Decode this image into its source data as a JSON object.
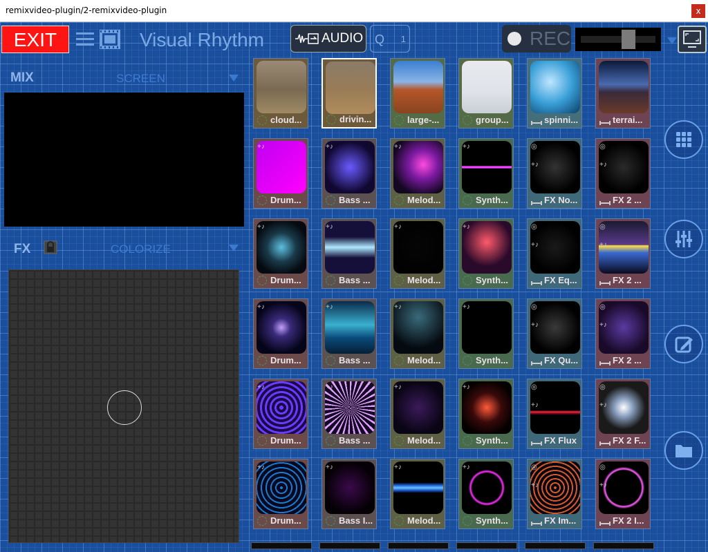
{
  "window": {
    "title": "remixvideo-plugin/2-remixvideo-plugin",
    "close_glyph": "x"
  },
  "toolbar": {
    "exit_label": "EXIT",
    "app_title": "Visual Rhythm",
    "audio_label": "AUDIO",
    "q_label": "Q",
    "q_value": "1",
    "rec_label": "REC",
    "rec_level": 0.67
  },
  "mix": {
    "label": "MIX",
    "screen_label": "SCREEN"
  },
  "fx": {
    "label": "FX",
    "effect_label": "COLORIZE"
  },
  "clips": [
    [
      {
        "label": "cloud...",
        "color": "#6d5a3a",
        "kind": "dot",
        "selected": false
      },
      {
        "label": "drivin...",
        "color": "#6d5a3a",
        "kind": "dot",
        "selected": true
      },
      {
        "label": "large-...",
        "color": "#556b47",
        "kind": "dot",
        "selected": false
      },
      {
        "label": "group...",
        "color": "#556b47",
        "kind": "dot",
        "selected": false
      },
      {
        "label": "spinni...",
        "color": "#436e7a",
        "kind": "fx",
        "selected": false
      },
      {
        "label": "terrai...",
        "color": "#6e4452",
        "kind": "fx",
        "selected": false
      }
    ],
    [
      {
        "label": "Drum...",
        "color": "#6d4a4a",
        "kind": "dot",
        "selected": false
      },
      {
        "label": "Bass ...",
        "color": "#5c5050",
        "kind": "dot",
        "selected": false
      },
      {
        "label": "Melod...",
        "color": "#5f5f45",
        "kind": "dot",
        "selected": false
      },
      {
        "label": "Synth...",
        "color": "#4a6a50",
        "kind": "dot",
        "selected": false
      },
      {
        "label": "FX No...",
        "color": "#3f6878",
        "kind": "fx",
        "selected": false
      },
      {
        "label": "FX 2 ...",
        "color": "#6e4452",
        "kind": "fx",
        "selected": false
      }
    ],
    [
      {
        "label": "Drum...",
        "color": "#6d4a4a",
        "kind": "dot",
        "selected": false
      },
      {
        "label": "Bass ...",
        "color": "#5c5050",
        "kind": "dot",
        "selected": false
      },
      {
        "label": "Melod...",
        "color": "#5f5f45",
        "kind": "dot",
        "selected": false
      },
      {
        "label": "Synth...",
        "color": "#4a6a50",
        "kind": "dot",
        "selected": false
      },
      {
        "label": "FX Eq...",
        "color": "#3f6878",
        "kind": "fx",
        "selected": false
      },
      {
        "label": "FX 2 ...",
        "color": "#6e4452",
        "kind": "fx",
        "selected": false
      }
    ],
    [
      {
        "label": "Drum...",
        "color": "#6d4a4a",
        "kind": "dot",
        "selected": false
      },
      {
        "label": "Bass ...",
        "color": "#5c5050",
        "kind": "dot",
        "selected": false
      },
      {
        "label": "Melod...",
        "color": "#5f5f45",
        "kind": "dot",
        "selected": false
      },
      {
        "label": "Synth...",
        "color": "#4a6a50",
        "kind": "dot",
        "selected": false
      },
      {
        "label": "FX Qu...",
        "color": "#3f6878",
        "kind": "fx",
        "selected": false
      },
      {
        "label": "FX 2 ...",
        "color": "#6e4452",
        "kind": "fx",
        "selected": false
      }
    ],
    [
      {
        "label": "Drum...",
        "color": "#6d4a4a",
        "kind": "dot",
        "selected": false
      },
      {
        "label": "Bass ...",
        "color": "#5c5050",
        "kind": "dot",
        "selected": false
      },
      {
        "label": "Melod...",
        "color": "#5f5f45",
        "kind": "dot",
        "selected": false
      },
      {
        "label": "Synth...",
        "color": "#4a6a50",
        "kind": "dot",
        "selected": false
      },
      {
        "label": "FX Flux",
        "color": "#3f6878",
        "kind": "fx",
        "selected": false
      },
      {
        "label": "FX 2 F...",
        "color": "#6e4452",
        "kind": "fx",
        "selected": false
      }
    ],
    [
      {
        "label": "Drum...",
        "color": "#6d4a4a",
        "kind": "dot",
        "selected": false
      },
      {
        "label": "Bass I...",
        "color": "#5c5050",
        "kind": "dot",
        "selected": false
      },
      {
        "label": "Melod...",
        "color": "#5f5f45",
        "kind": "dot",
        "selected": false
      },
      {
        "label": "Synth...",
        "color": "#4a6a50",
        "kind": "dot",
        "selected": false
      },
      {
        "label": "FX Im...",
        "color": "#3f6878",
        "kind": "fx",
        "selected": false
      },
      {
        "label": "FX 2 I...",
        "color": "#6e4452",
        "kind": "fx",
        "selected": false
      }
    ]
  ],
  "side_buttons": [
    "grid-icon",
    "mixer-icon",
    "edit-icon",
    "folder-icon"
  ],
  "colors": {
    "accent": "#1a4f9e",
    "exit": "#ff1414",
    "title": "#7aaae6"
  }
}
